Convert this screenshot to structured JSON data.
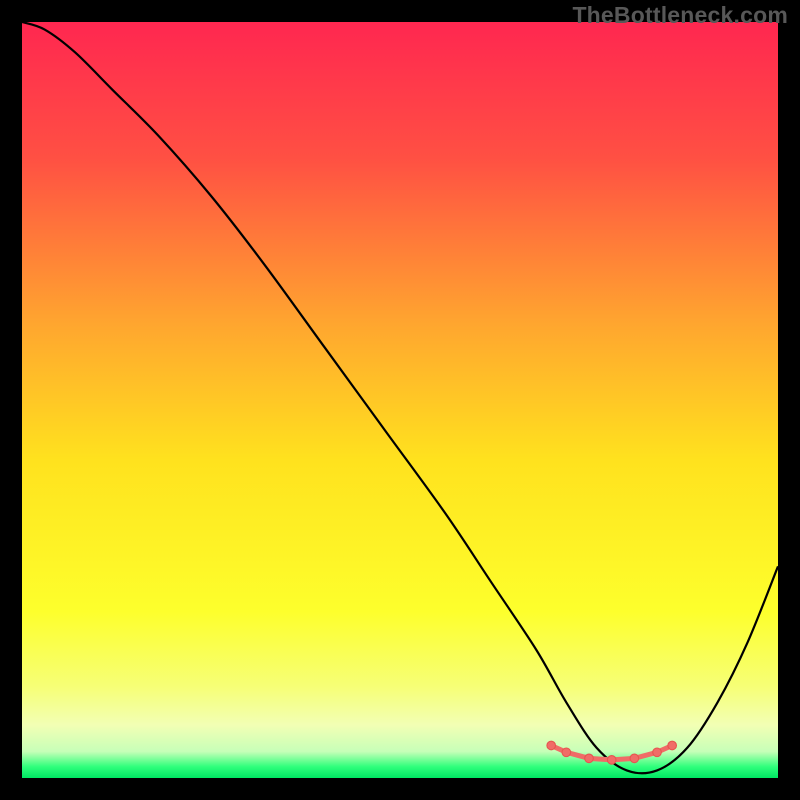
{
  "watermark": "TheBottleneck.com",
  "chart_data": {
    "type": "line",
    "title": "",
    "xlabel": "",
    "ylabel": "",
    "xlim": [
      0,
      100
    ],
    "ylim": [
      0,
      100
    ],
    "legend": false,
    "grid": false,
    "background": {
      "type": "vertical_gradient",
      "stops": [
        {
          "offset": 0.0,
          "color": "#ff2750"
        },
        {
          "offset": 0.18,
          "color": "#ff5043"
        },
        {
          "offset": 0.4,
          "color": "#ffa62f"
        },
        {
          "offset": 0.58,
          "color": "#ffe21e"
        },
        {
          "offset": 0.78,
          "color": "#fdff2c"
        },
        {
          "offset": 0.88,
          "color": "#f6ff77"
        },
        {
          "offset": 0.93,
          "color": "#f2ffb4"
        },
        {
          "offset": 0.965,
          "color": "#c7ffb8"
        },
        {
          "offset": 0.985,
          "color": "#2fff7c"
        },
        {
          "offset": 1.0,
          "color": "#00e763"
        }
      ]
    },
    "series": [
      {
        "name": "bottleneck-curve",
        "color": "#000000",
        "width": 2.2,
        "x": [
          0,
          3,
          7,
          12,
          18,
          25,
          32,
          40,
          48,
          56,
          62,
          68,
          72,
          76,
          80,
          84,
          88,
          92,
          96,
          100
        ],
        "values": [
          100,
          99,
          96,
          91,
          85,
          77,
          68,
          57,
          46,
          35,
          26,
          17,
          10,
          4,
          1,
          1,
          4,
          10,
          18,
          28
        ]
      }
    ],
    "highlight": {
      "name": "trough-marker",
      "color": "#f06c67",
      "stroke": "#e6554f",
      "dot_radius": 4.3,
      "line_width": 5,
      "points_x": [
        70,
        72,
        75,
        78,
        81,
        84,
        86
      ],
      "points_y": [
        4.3,
        3.4,
        2.6,
        2.4,
        2.6,
        3.4,
        4.3
      ]
    }
  }
}
